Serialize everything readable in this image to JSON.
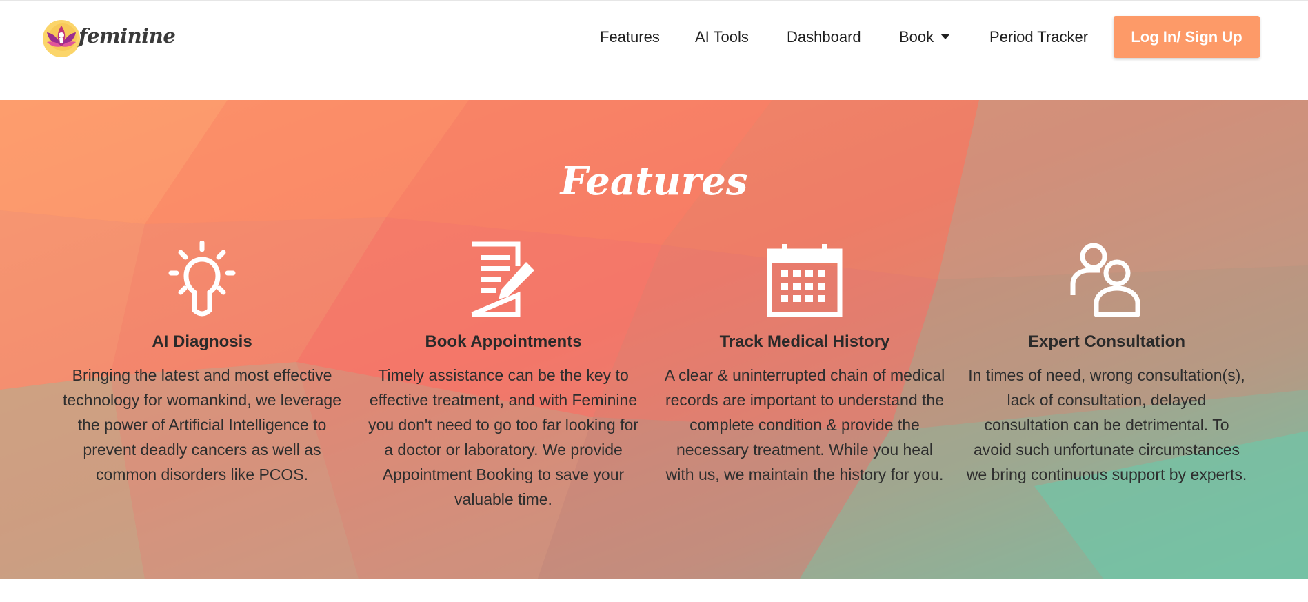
{
  "brand": {
    "name": "feminine"
  },
  "nav": {
    "items": [
      {
        "label": "Features"
      },
      {
        "label": "AI Tools"
      },
      {
        "label": "Dashboard"
      },
      {
        "label": "Book"
      },
      {
        "label": "Period Tracker"
      }
    ],
    "login_label": "Log In/ Sign Up"
  },
  "colors": {
    "accent": "#fd9a68",
    "hero_coral": "#f47a66",
    "hero_teal": "#74c2a4"
  },
  "features": {
    "title": "Features",
    "items": [
      {
        "icon": "lightbulb-icon",
        "title": "AI Diagnosis",
        "text": "Bringing the latest and most effective technology for womankind, we leverage the power of Artificial Intelligence to prevent deadly cancers as well as common disorders like PCOS."
      },
      {
        "icon": "document-edit-icon",
        "title": "Book Appointments",
        "text": "Timely assistance can be the key to effective treatment, and with Feminine you don't need to go too far looking for a doctor or laboratory. We provide Appointment Booking to save your valuable time."
      },
      {
        "icon": "calendar-icon",
        "title": "Track Medical History",
        "text": "A clear & uninterrupted chain of medical records are important to understand the complete condition & provide the necessary treatment. While you heal with us, we maintain the history for you."
      },
      {
        "icon": "users-icon",
        "title": "Expert Consultation",
        "text": "In times of need, wrong consultation(s), lack of consultation, delayed consultation can be detrimental. To avoid such unfortunate circumstances we bring continuous support by experts."
      }
    ]
  }
}
